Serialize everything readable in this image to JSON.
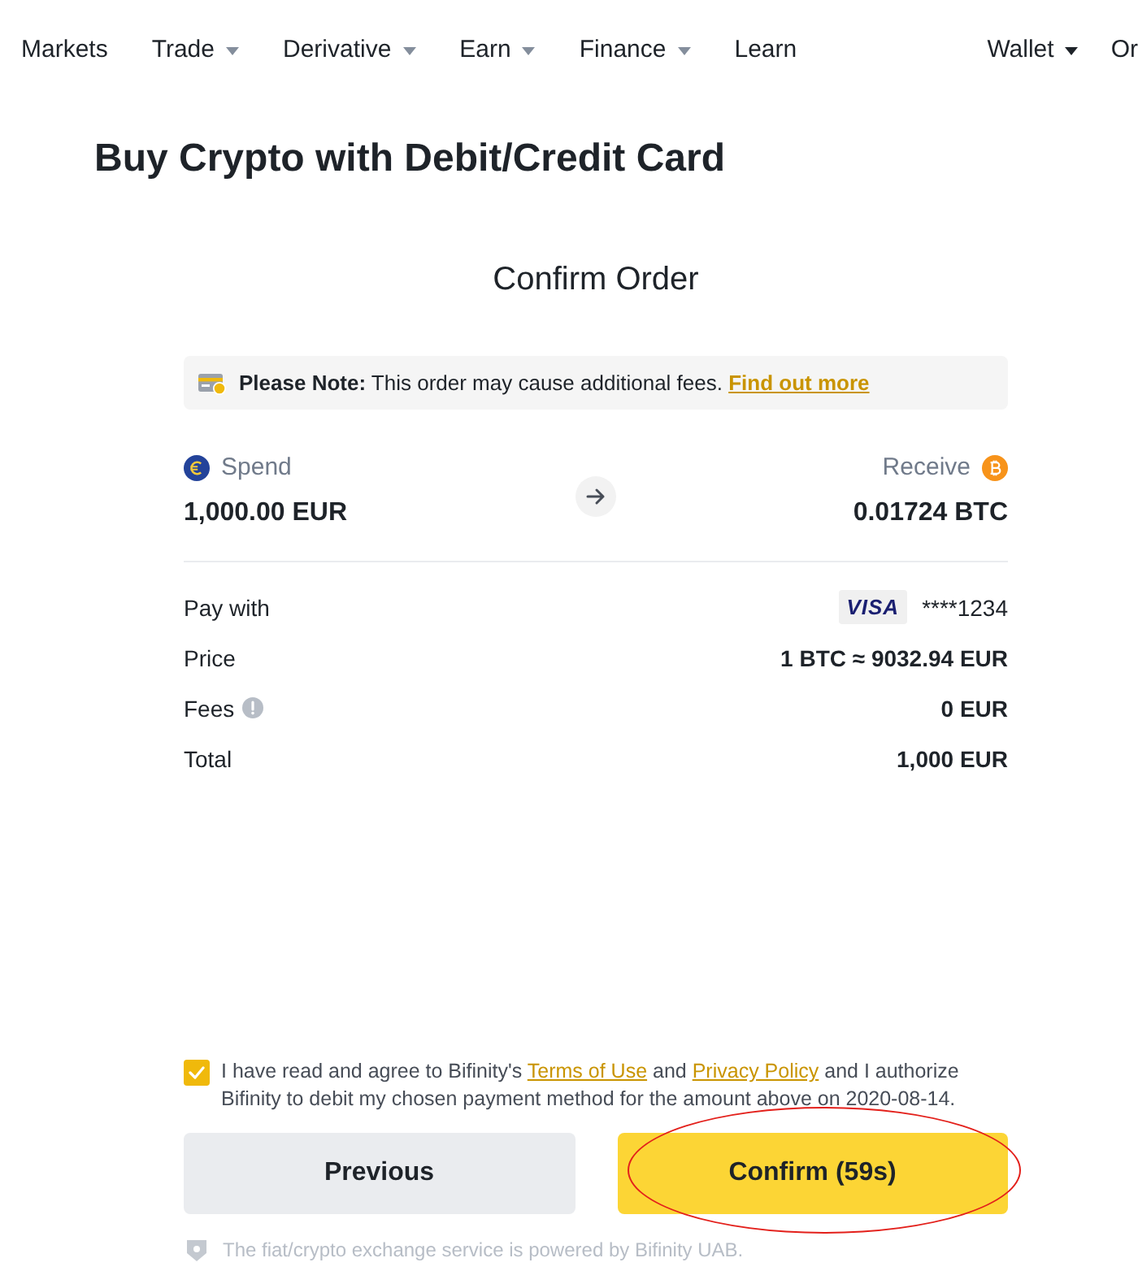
{
  "nav": {
    "items": [
      {
        "label": "Markets",
        "dropdown": false
      },
      {
        "label": "Trade",
        "dropdown": true
      },
      {
        "label": "Derivative",
        "dropdown": true
      },
      {
        "label": "Earn",
        "dropdown": true
      },
      {
        "label": "Finance",
        "dropdown": true
      },
      {
        "label": "Learn",
        "dropdown": false
      }
    ],
    "right_items": [
      {
        "label": "Wallet",
        "dropdown": true
      },
      {
        "label": "Or",
        "dropdown": false
      }
    ]
  },
  "page_title": "Buy Crypto with Debit/Credit Card",
  "section_title": "Confirm Order",
  "note": {
    "text": "**Please Note:** This order may cause additional fees.",
    "link": "Find out more"
  },
  "exchange": {
    "spend": {
      "label": "Spend",
      "amount": "1,000.00 EUR"
    },
    "receive": {
      "label": "Receive",
      "amount": "0.01724 BTC"
    }
  },
  "details": [
    {
      "kind": "card",
      "label": "Pay with",
      "card_brand": "VISA",
      "value": "****1234",
      "info": false
    },
    {
      "kind": "plain",
      "label": "Price",
      "value": "1 BTC ≈ 9032.94 EUR",
      "info": false
    },
    {
      "kind": "plain",
      "label": "Fees",
      "value": "0 EUR",
      "info": true
    },
    {
      "kind": "plain",
      "label": "Total",
      "value": "1,000 EUR",
      "info": false
    }
  ],
  "agreement": {
    "checked": true,
    "segments": [
      {
        "kind": "text",
        "text": "I have read and agree to Bifinity's "
      },
      {
        "kind": "link",
        "text": "Terms of Use"
      },
      {
        "kind": "text",
        "text": " and "
      },
      {
        "kind": "link",
        "text": "Privacy Policy"
      },
      {
        "kind": "text",
        "text": " and I authorize Bifinity to debit my chosen payment method for the amount above on 2020-08-14."
      }
    ]
  },
  "buttons": [
    {
      "label": "Previous",
      "kind": "secondary",
      "circled": false
    },
    {
      "label": "Confirm (59s)",
      "kind": "primary",
      "circled": true
    }
  ],
  "footer": "The fiat/crypto exchange service is powered by Bifinity UAB."
}
